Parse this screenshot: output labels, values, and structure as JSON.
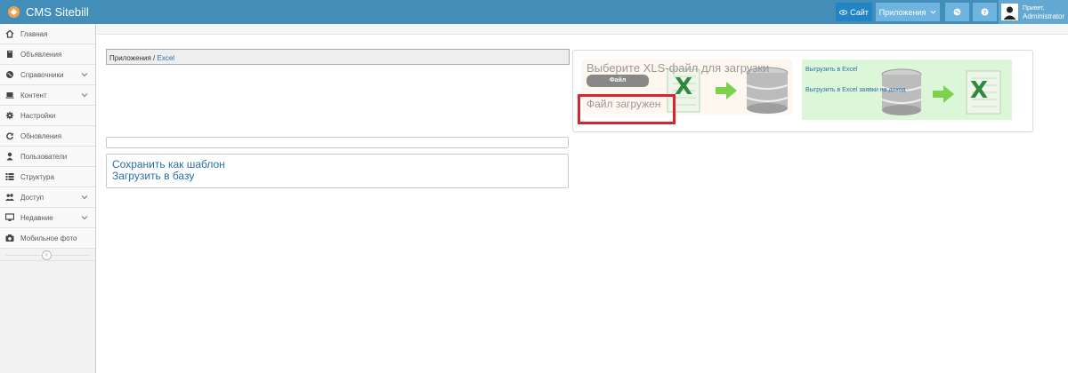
{
  "app": {
    "title": "CMS Sitebill"
  },
  "navbar": {
    "site_label": "Сайт",
    "apps_label": "Приложения",
    "greeting": "Привет,",
    "username": "Administrator"
  },
  "sidebar": {
    "items": [
      {
        "label": "Главная",
        "icon": "home-icon",
        "expandable": false
      },
      {
        "label": "Объявления",
        "icon": "book-icon",
        "expandable": false
      },
      {
        "label": "Справочники",
        "icon": "globe-icon",
        "expandable": true
      },
      {
        "label": "Контент",
        "icon": "laptop-icon",
        "expandable": true
      },
      {
        "label": "Настройки",
        "icon": "gear-icon",
        "expandable": false
      },
      {
        "label": "Обновления",
        "icon": "refresh-icon",
        "expandable": false
      },
      {
        "label": "Пользователи",
        "icon": "user-icon",
        "expandable": false
      },
      {
        "label": "Структура",
        "icon": "list-icon",
        "expandable": false
      },
      {
        "label": "Доступ",
        "icon": "users-icon",
        "expandable": true
      },
      {
        "label": "Недавние",
        "icon": "desktop-icon",
        "expandable": true
      },
      {
        "label": "Мобильное фото",
        "icon": "camera-icon",
        "expandable": false
      }
    ]
  },
  "breadcrumb": {
    "root": "Приложения",
    "separator": "/",
    "current": "Excel"
  },
  "actions": {
    "save_template": "Сохранить как шаблон",
    "load_db": "Загрузить в базу"
  },
  "import": {
    "title": "Выберите XLS-файл для загрузки",
    "file_button": "Файл",
    "status": "Файл загружен"
  },
  "export": {
    "link1": "Выгрузить в Excel",
    "link2": "Выгрузить в Excel заявки на доход"
  },
  "colors": {
    "navbar": "#438eb9",
    "highlight": "#d9232d",
    "export_bg": "#dcf7d8",
    "import_bg": "#fdf7ef",
    "link": "#2a6fa8"
  }
}
